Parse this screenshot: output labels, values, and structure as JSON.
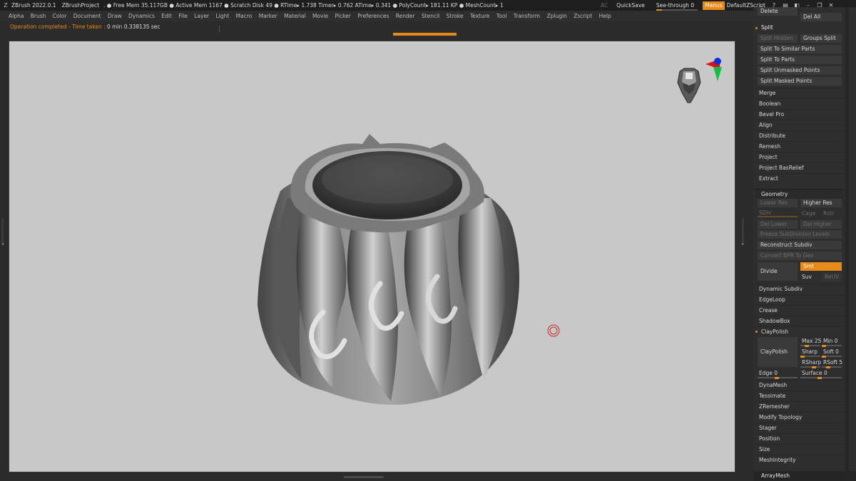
{
  "titlebar": {
    "app_title": "ZBrush 2022.0.1",
    "project": "ZBrushProject",
    "stats": ". ● Free Mem 35.117GB ● Active Mem 1167 ● Scratch Disk 49 ●  RTime▸ 1.738 Timer▸ 0.762 ATime▸ 0.341 ● PolyCount▸ 181.11 KP  ● MeshCount▸ 1",
    "ac": "AC",
    "quicksave": "QuickSave",
    "seethrough": "See-through  0",
    "seethrough_value": 0,
    "menus": "Menus",
    "default_script": "DefaultZScript"
  },
  "menubar": {
    "items": [
      "Alpha",
      "Brush",
      "Color",
      "Document",
      "Draw",
      "Dynamics",
      "Edit",
      "File",
      "Layer",
      "Light",
      "Macro",
      "Marker",
      "Material",
      "Movie",
      "Picker",
      "Preferences",
      "Render",
      "Stencil",
      "Stroke",
      "Texture",
      "Tool",
      "Transform",
      "Zplugin",
      "Zscript",
      "Help"
    ]
  },
  "status": {
    "prefix": "Operation completed - Time taken : ",
    "minutes": "0",
    "min_label": " min ",
    "seconds": "0.338135",
    "sec_label": " sec"
  },
  "panel": {
    "delete": "Delete",
    "del_all": "Del All",
    "split_header": "Split",
    "split_hidden": "Split Hidden",
    "groups_split": "Groups Split",
    "split_similar": "Split To Similar Parts",
    "split_parts": "Split To Parts",
    "split_unmasked": "Split Unmasked Points",
    "split_masked": "Split Masked Points",
    "merge": "Merge",
    "boolean": "Boolean",
    "bevel_pro": "Bevel Pro",
    "align": "Align",
    "distribute": "Distribute",
    "remesh": "Remesh",
    "project": "Project",
    "project_bas": "Project BasRelief",
    "extract": "Extract",
    "geometry_header": "Geometry",
    "lower_res": "Lower Res",
    "higher_res": "Higher Res",
    "sdiv": "SDiv",
    "cage": "Cage",
    "rstr": "Rstr",
    "del_lower": "Del Lower",
    "del_higher": "Del Higher",
    "freeze": "Freeze SubDivision Levels",
    "reconstruct": "Reconstruct Subdiv",
    "convert_bpr": "Convert BPR To Geo",
    "divide": "Divide",
    "smt": "Smt",
    "suv": "Suv",
    "reluv": "ReUV",
    "dynamic_subdiv": "Dynamic Subdiv",
    "edgeloop": "EdgeLoop",
    "crease": "Crease",
    "shadowbox": "ShadowBox",
    "claypolish_header": "ClayPolish",
    "claypolish_btn": "ClayPolish",
    "max": "Max 25",
    "min": "Min 0",
    "sharp": "Sharp",
    "soft": "Soft 0",
    "rsharp": "RSharp",
    "rsoft": "RSoft 5",
    "edge": "Edge 0",
    "surface": "Surface 0",
    "dynamesh": "DynaMesh",
    "tessimate": "Tessimate",
    "zremesher": "ZRemesher",
    "modify_topology": "Modify Topology",
    "stager": "Stager",
    "position": "Position",
    "size": "Size",
    "meshintegrity": "MeshIntegrity",
    "arraymesh": "ArrayMesh"
  },
  "colors": {
    "accent": "#e88a1a",
    "viewport_bg": "#c8c8c8",
    "panel_bg": "#2e2e2e"
  }
}
